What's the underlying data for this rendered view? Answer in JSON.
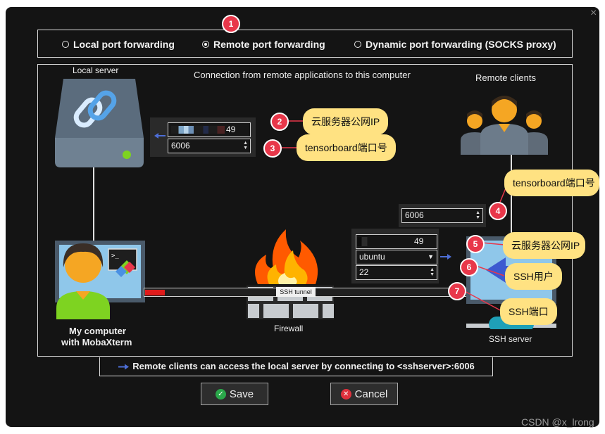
{
  "dialog": {
    "close_glyph": "×",
    "modes": [
      {
        "label": "Local port forwarding",
        "selected": false
      },
      {
        "label": "Remote port forwarding",
        "selected": true
      },
      {
        "label": "Dynamic port forwarding (SOCKS proxy)",
        "selected": false
      }
    ],
    "diagram": {
      "caption": "Connection from remote applications to this computer",
      "local_server_label": "Local server",
      "remote_clients_label": "Remote clients",
      "my_computer_label_line1": "My computer",
      "my_computer_label_line2": "with MobaXterm",
      "firewall_label": "Firewall",
      "ssh_server_label": "SSH server",
      "tunnel_label": "SSH tunnel",
      "local_host_value": "49",
      "local_port_value": "6006",
      "remote_port_value": "6006",
      "ssh_host_value": "49",
      "ssh_user_value": "ubuntu",
      "ssh_port_value": "22"
    },
    "hint_text": "Remote clients can access the local server by connecting to <sshserver>:6006",
    "save_label": "Save",
    "cancel_label": "Cancel"
  },
  "annotations": {
    "markers": [
      "1",
      "2",
      "3",
      "4",
      "5",
      "6",
      "7"
    ],
    "bubble_2": "云服务器公网IP",
    "bubble_3": "tensorboard端口号",
    "bubble_4": "tensorboard端口号",
    "bubble_5": "云服务器公网IP",
    "bubble_6": "SSH用户",
    "bubble_7": "SSH端口",
    "marker_color": "#e8374a",
    "bubble_color": "#ffe282"
  },
  "watermark": "CSDN @x_lrong",
  "icons": [
    "chain-link-icon",
    "people-icon",
    "fire-icon",
    "terminal-icon",
    "arrow-left-icon",
    "arrow-right-icon",
    "check-icon",
    "cancel-x-icon"
  ]
}
